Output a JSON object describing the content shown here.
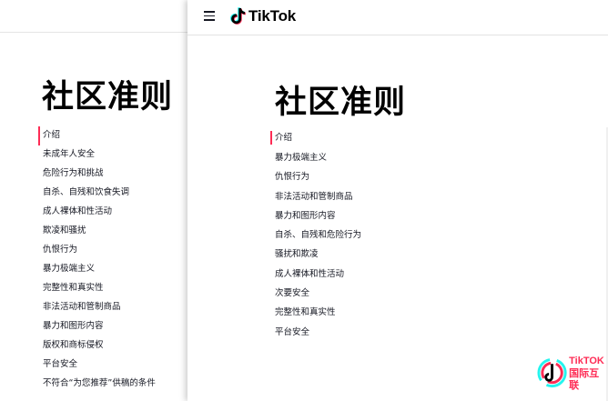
{
  "left_page": {
    "title": "社区准则",
    "nav_items": [
      "介绍",
      "未成年人安全",
      "危险行为和挑战",
      "自杀、自残和饮食失调",
      "成人裸体和性活动",
      "欺凌和骚扰",
      "仇恨行为",
      "暴力极端主义",
      "完整性和真实性",
      "非法活动和管制商品",
      "暴力和图形内容",
      "版权和商标侵权",
      "平台安全",
      "不符合“为您推荐”供稿的条件"
    ],
    "active_index": 0
  },
  "right_page": {
    "header": {
      "logo_text": "TikTok",
      "menu_icon": "hamburger-menu-icon"
    },
    "title": "社区准则",
    "nav_items": [
      "介绍",
      "暴力极端主义",
      "仇恨行为",
      "非法活动和管制商品",
      "暴力和图形内容",
      "自杀、自残和危险行为",
      "骚扰和欺凌",
      "成人裸体和性活动",
      "次要安全",
      "完整性和真实性",
      "平台安全"
    ],
    "active_index": 0
  },
  "watermark": {
    "line1": "TikTOK",
    "line2": "国际互联"
  },
  "colors": {
    "accent": "#fe2c55",
    "cyan": "#25f4ee",
    "text": "#161823"
  }
}
